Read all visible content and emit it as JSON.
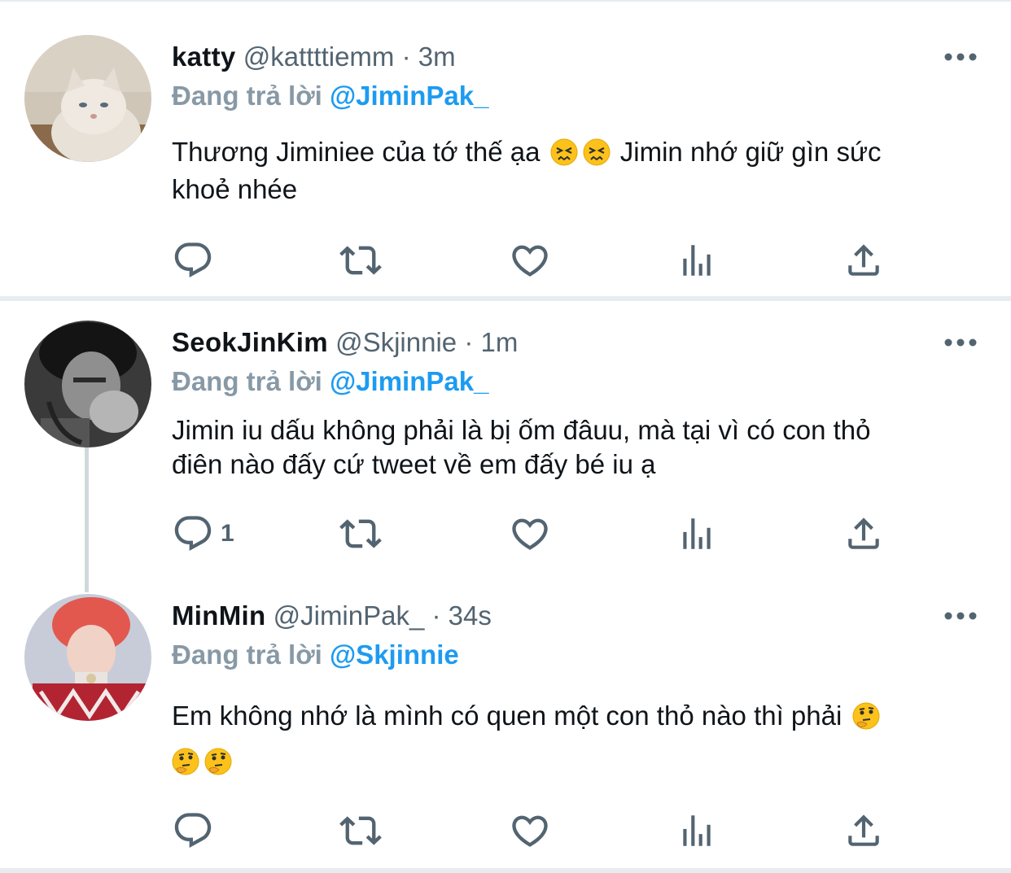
{
  "tweets": [
    {
      "name": "katty",
      "handle": "@kattttiemm",
      "time": "· 3m",
      "reply_prefix": "Đang trả lời",
      "reply_to": "@JiminPak_",
      "text_a": "Thương Jiminiee của tớ thế ạa",
      "text_b": "Jimin nhớ giữ gìn sức",
      "text_c": "khoẻ nhée",
      "emojis": [
        "persevering-face",
        "persevering-face"
      ],
      "reply_count": ""
    },
    {
      "name": "SeokJinKim",
      "handle": "@Skjinnie",
      "time": "· 1m",
      "reply_prefix": "Đang trả lời",
      "reply_to": "@JiminPak_",
      "text_a": "Jimin iu dấu không phải là bị ốm đâuu, mà tại vì có con thỏ",
      "text_b": "điên nào đấy cứ tweet về em đấy bé iu ạ",
      "reply_count": "1"
    },
    {
      "name": "MinMin",
      "handle": "@JiminPak_",
      "time": "· 34s",
      "reply_prefix": "Đang trả lời",
      "reply_to": "@Skjinnie",
      "text_a": "Em không nhớ là mình có quen một con thỏ nào thì phải",
      "emojis": [
        "thinking-face",
        "thinking-face",
        "thinking-face"
      ],
      "reply_count": ""
    }
  ],
  "colors": {
    "text": "#0f1419",
    "secondary": "#536471",
    "reply_prefix": "#8899a6",
    "link": "#1d9bf0",
    "separator": "#e6ecf0",
    "thread_line": "#cfd9de"
  },
  "icons": [
    "more-icon",
    "reply-icon",
    "retweet-icon",
    "like-icon",
    "analytics-icon",
    "share-icon"
  ]
}
